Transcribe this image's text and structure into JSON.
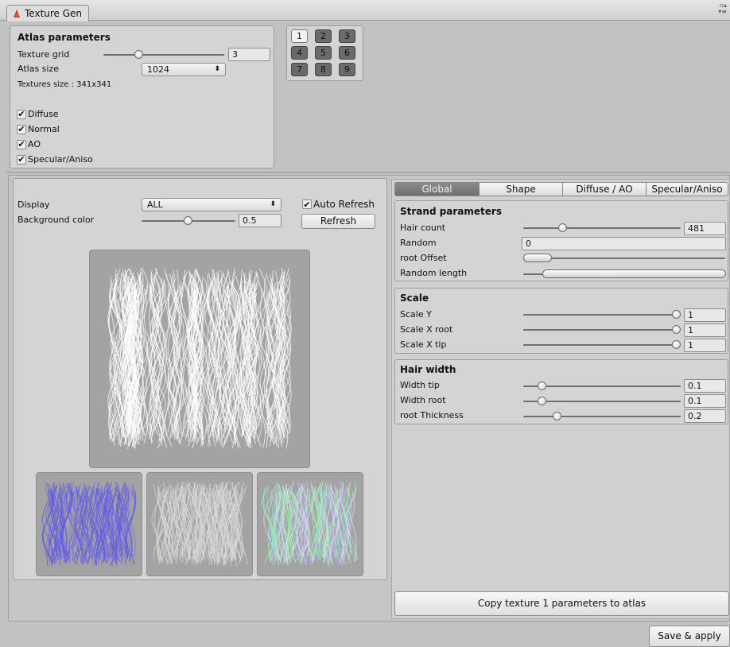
{
  "window": {
    "tab_title": "Texture Gen"
  },
  "atlas": {
    "title": "Atlas parameters",
    "texture_grid_label": "Texture grid",
    "texture_grid_value": "3",
    "texture_grid_fraction": 0.3,
    "atlas_size_label": "Atlas size",
    "atlas_size_value": "1024",
    "textures_size_text": "Textures size : 341x341",
    "channels": [
      {
        "label": "Diffuse",
        "checked": true
      },
      {
        "label": "Normal",
        "checked": true
      },
      {
        "label": "AO",
        "checked": true
      },
      {
        "label": "Specular/Aniso",
        "checked": true
      }
    ]
  },
  "grid_buttons": [
    {
      "label": "1",
      "active": true
    },
    {
      "label": "2",
      "active": false
    },
    {
      "label": "3",
      "active": false
    },
    {
      "label": "4",
      "active": false
    },
    {
      "label": "5",
      "active": false
    },
    {
      "label": "6",
      "active": false
    },
    {
      "label": "7",
      "active": false
    },
    {
      "label": "8",
      "active": false
    },
    {
      "label": "9",
      "active": false
    }
  ],
  "preview": {
    "display_label": "Display",
    "display_value": "ALL",
    "bg_color_label": "Background color",
    "bg_color_value": "0.5",
    "bg_color_fraction": 0.5,
    "auto_refresh_label": "Auto Refresh",
    "auto_refresh_checked": true,
    "refresh_label": "Refresh",
    "colors": {
      "main_bg": "#a3a3a3",
      "normal_tint": "#5a5ae6",
      "ao_tint": "#d9d9d9",
      "spec_tint": "#8af0c8"
    }
  },
  "tabs": [
    {
      "label": "Global",
      "active": true
    },
    {
      "label": "Shape",
      "active": false
    },
    {
      "label": "Diffuse / AO",
      "active": false
    },
    {
      "label": "Specular/Aniso",
      "active": false
    }
  ],
  "strand": {
    "title": "Strand parameters",
    "hair_count_label": "Hair count",
    "hair_count_value": "481",
    "hair_count_fraction": 0.2,
    "random_label": "Random",
    "random_value": "0",
    "root_offset_label": "root Offset",
    "random_length_label": "Random length"
  },
  "scale": {
    "title": "Scale",
    "scale_y_label": "Scale Y",
    "scale_y_value": "1",
    "scale_x_root_label": "Scale X root",
    "scale_x_root_value": "1",
    "scale_x_tip_label": "Scale X tip",
    "scale_x_tip_value": "1"
  },
  "hair_width": {
    "title": "Hair width",
    "width_tip_label": "Width tip",
    "width_tip_value": "0.1",
    "width_root_label": "Width root",
    "width_root_value": "0.1",
    "root_thickness_label": "root Thickness",
    "root_thickness_value": "0.2"
  },
  "copy_button_label": "Copy texture 1 parameters to atlas",
  "save_apply_label": "Save & apply"
}
